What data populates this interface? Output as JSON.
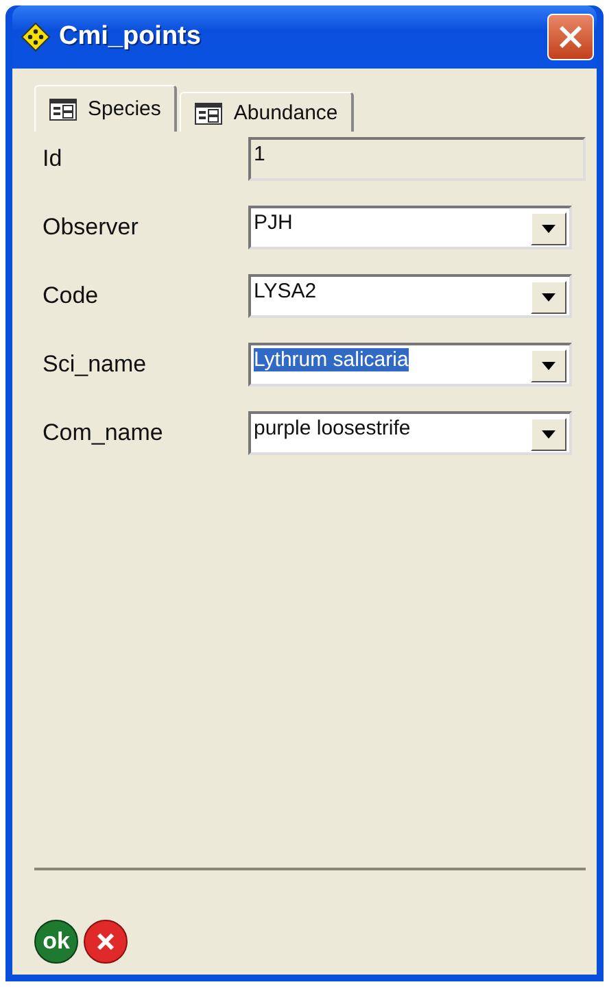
{
  "window": {
    "title": "Cmi_points"
  },
  "tabs": [
    {
      "label": "Species",
      "selected": true
    },
    {
      "label": "Abundance",
      "selected": false
    }
  ],
  "fields": [
    {
      "label": "Id",
      "value": "1",
      "kind": "readonly",
      "text_selected": false
    },
    {
      "label": "Observer",
      "value": "PJH",
      "kind": "dropdown",
      "text_selected": false
    },
    {
      "label": "Code",
      "value": "LYSA2",
      "kind": "dropdown",
      "text_selected": false
    },
    {
      "label": "Sci_name",
      "value": "Lythrum salicaria",
      "kind": "dropdown",
      "text_selected": true
    },
    {
      "label": "Com_name",
      "value": "purple loosestrife",
      "kind": "dropdown",
      "text_selected": false
    }
  ],
  "buttons": {
    "ok": "ok"
  }
}
